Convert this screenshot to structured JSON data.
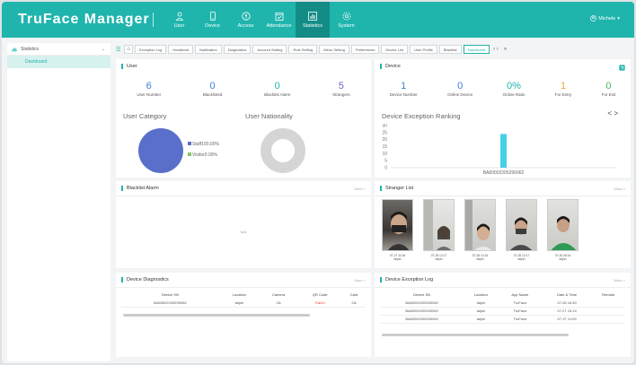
{
  "app": {
    "title": "TruFace Manager"
  },
  "nav": [
    {
      "label": "User",
      "icon": "user-icon"
    },
    {
      "label": "Device",
      "icon": "device-icon"
    },
    {
      "label": "Access",
      "icon": "access-icon"
    },
    {
      "label": "Attendance",
      "icon": "attendance-icon"
    },
    {
      "label": "Statistics",
      "icon": "statistics-icon",
      "active": true
    },
    {
      "label": "System",
      "icon": "system-icon"
    }
  ],
  "user_menu": {
    "name": "Michele"
  },
  "sidebar": {
    "header": "Statistics",
    "item": "Dashboard"
  },
  "tabs": [
    "Exception Log",
    "Heartbeat",
    "Notification",
    "Diagnostics",
    "Account Setting",
    "Role Setting",
    "Menu Setting",
    "Preferences",
    "Device List",
    "User Profile",
    "Blacklist",
    "Dashboard"
  ],
  "user_panel": {
    "title": "User",
    "stats": [
      {
        "value": "6",
        "label": "User Number"
      },
      {
        "value": "0",
        "label": "Blacklisted"
      },
      {
        "value": "0",
        "label": "Blacklist Alarm"
      },
      {
        "value": "5",
        "label": "Strangers"
      }
    ],
    "category_title": "User Category",
    "nationality_title": "User Nationality",
    "legend": [
      {
        "label": "Staff100.00%",
        "color": "#5a6fc9"
      },
      {
        "label": "Visitor0.00%",
        "color": "#86c76a"
      }
    ]
  },
  "device_panel": {
    "title": "Device",
    "stats": [
      {
        "value": "1",
        "label": "Device Number"
      },
      {
        "value": "0",
        "label": "Online Device"
      },
      {
        "value": "0%",
        "label": "Online Ratio"
      },
      {
        "value": "1",
        "label": "For Entry"
      },
      {
        "value": "0",
        "label": "For Exit"
      }
    ],
    "ranking_title": "Device Exception Ranking",
    "nav_label": "< >"
  },
  "chart_data": {
    "type": "bar",
    "categories": [
      "BA83002205290062"
    ],
    "values": [
      24
    ],
    "ylim": [
      0,
      30
    ],
    "yticks": [
      "30",
      "25",
      "20",
      "15",
      "10",
      "5",
      "0"
    ],
    "bar_color": "#46d0e6"
  },
  "blacklist_panel": {
    "title": "Blacklist Alarm",
    "more": "More >",
    "empty": "N/A"
  },
  "stranger_panel": {
    "title": "Stranger List",
    "more": "More >",
    "items": [
      {
        "time": "07-27 11:06",
        "place": "taipei"
      },
      {
        "time": "07-28 12:17",
        "place": "taipei"
      },
      {
        "time": "07-28 10:16",
        "place": "taipei"
      },
      {
        "time": "07-28 13:17",
        "place": "taipei"
      },
      {
        "time": "07-28 08:16",
        "place": "taipei"
      }
    ]
  },
  "diag_panel": {
    "title": "Device Diagnostics",
    "more": "More >",
    "headers": [
      "Device SN",
      "Location",
      "Camera",
      "QR Code",
      "Card"
    ],
    "rows": [
      {
        "sn": "BA83002205290062",
        "location": "taipei",
        "camera": "Ok",
        "qr": "Failed",
        "card": "Ok"
      }
    ]
  },
  "exlog_panel": {
    "title": "Device Exception Log",
    "more": "More >",
    "headers": [
      "Device SN",
      "Location",
      "App Name",
      "Date & Time",
      "Remark"
    ],
    "rows": [
      {
        "sn": "BA83002205290062",
        "location": "taipei",
        "app": "TruFace",
        "time": "07-26 16:30"
      },
      {
        "sn": "BA83002205290062",
        "location": "taipei",
        "app": "TruFace",
        "time": "07-27 15:14"
      },
      {
        "sn": "BA83002205290062",
        "location": "taipei",
        "app": "TruFace",
        "time": "07-27 11:09"
      }
    ]
  }
}
